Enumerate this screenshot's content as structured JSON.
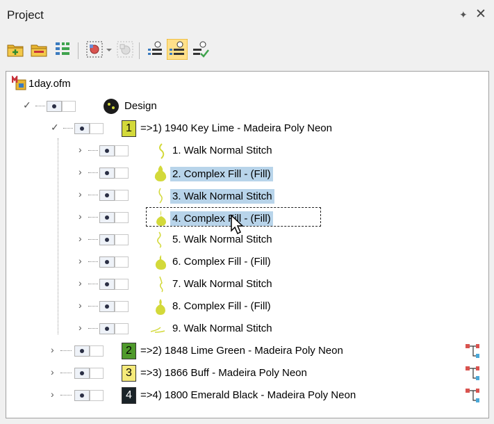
{
  "panel": {
    "title": "Project",
    "pin_icon": "pin-icon",
    "close_icon": "close-icon"
  },
  "toolbar": {
    "buttons": [
      "add-folder-icon",
      "open-folder-icon",
      "hierarchy-icon",
      "object-properties-icon",
      "dropdown-arrow-icon",
      "disabled-object-icon",
      "list-view-icon",
      "list-view-highlight-icon",
      "list-check-icon"
    ]
  },
  "tree": {
    "file": {
      "label": "1day.ofm"
    },
    "design": {
      "label": "Design"
    },
    "colors": [
      {
        "num": "1",
        "label": "=>1) 1940 Key Lime - Madeira Poly Neon",
        "swatch": "#d3d93a",
        "text": "#000000"
      },
      {
        "num": "2",
        "label": "=>2) 1848 Lime Green - Madeira Poly Neon",
        "swatch": "#4f9a2b",
        "text": "#000000"
      },
      {
        "num": "3",
        "label": "=>3) 1866 Buff - Madeira Poly Neon",
        "swatch": "#f5ea7a",
        "text": "#000000"
      },
      {
        "num": "4",
        "label": "=>4) 1800 Emerald Black - Madeira Poly Neon",
        "swatch": "#1a2328",
        "text": "#ffffff"
      }
    ],
    "stitches": [
      {
        "label": "1. Walk Normal Stitch"
      },
      {
        "label": "2. Complex Fill - (Fill)"
      },
      {
        "label": "3. Walk Normal Stitch"
      },
      {
        "label": "4. Complex Fill - (Fill)"
      },
      {
        "label": "5. Walk Normal Stitch"
      },
      {
        "label": "6. Complex Fill - (Fill)"
      },
      {
        "label": "7. Walk Normal Stitch"
      },
      {
        "label": "8. Complex Fill - (Fill)"
      },
      {
        "label": "9. Walk Normal Stitch"
      }
    ]
  },
  "colors": {
    "selection": "#b8d4ea",
    "thread": "#d3d93a"
  }
}
